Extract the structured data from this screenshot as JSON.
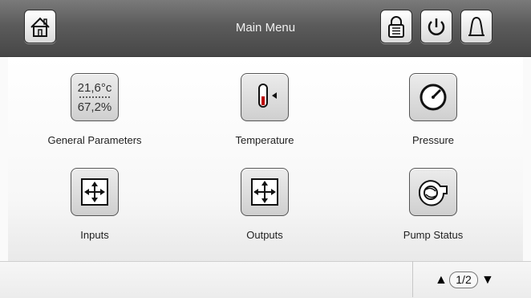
{
  "header": {
    "title": "Main Menu",
    "home_icon": "home-icon",
    "lock_icon": "lock-icon",
    "power_icon": "power-icon",
    "bell_icon": "bell-icon"
  },
  "menu": {
    "items": [
      {
        "label": "General Parameters",
        "icon": "general-parameters-icon",
        "line1": "21,6°c",
        "line2": "67,2%"
      },
      {
        "label": "Temperature",
        "icon": "thermometer-icon"
      },
      {
        "label": "Pressure",
        "icon": "pressure-gauge-icon"
      },
      {
        "label": "Inputs",
        "icon": "inputs-icon"
      },
      {
        "label": "Outputs",
        "icon": "outputs-icon"
      },
      {
        "label": "Pump Status",
        "icon": "pump-icon"
      }
    ]
  },
  "footer": {
    "page": "1/2",
    "up_symbol": "▲",
    "down_symbol": "▼"
  },
  "colors": {
    "header_bg": "#5b5b5b",
    "button_border": "#2e2e2e",
    "label_text": "#222222"
  }
}
